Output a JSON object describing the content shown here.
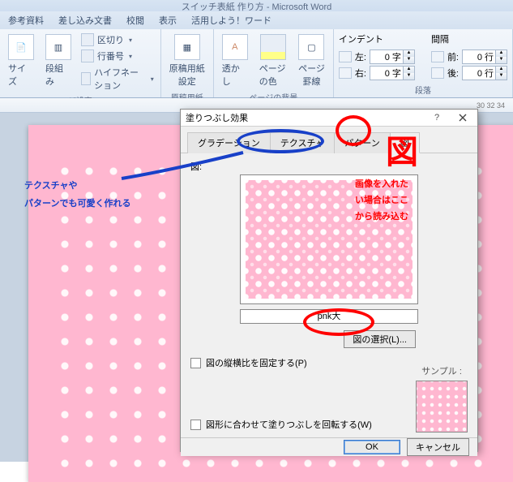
{
  "app_title": "スイッチ表紙 作り方 - Microsoft Word",
  "ribbon_tabs": [
    "参考資料",
    "差し込み文書",
    "校閲",
    "表示",
    "活用しよう！ワード"
  ],
  "ribbon": {
    "group_page_setup": {
      "size_btn": "サイズ",
      "columns_btn": "段組み",
      "breaks": "区切り",
      "line_numbers": "行番号",
      "hyphenation": "ハイフネーション",
      "label": "ジ設定"
    },
    "group_genkou": {
      "btn": "原稿用紙\n設定",
      "label": "原稿用紙"
    },
    "group_bg": {
      "watermark": "透かし",
      "page_color": "ページの色",
      "page_border": "ページ\n罫線",
      "label": "ページの背景"
    },
    "group_para": {
      "title": "インデント",
      "left_label": "左:",
      "left_val": "0 字",
      "right_label": "右:",
      "right_val": "0 字",
      "spacing_title": "間隔",
      "before_label": "前:",
      "before_val": "0 行",
      "after_label": "後:",
      "after_val": "0 行",
      "label": "段落"
    }
  },
  "ruler_text": "30    32    34",
  "dialog": {
    "title": "塗りつぶし効果",
    "tabs": [
      "グラデーション",
      "テクスチャ",
      "パターン",
      "図"
    ],
    "active_tab": 3,
    "section_label": "図:",
    "image_name": "pnk大",
    "pick_button": "図の選択(L)...",
    "lock_aspect": "図の縦横比を固定する(P)",
    "rotate_fill": "図形に合わせて塗りつぶしを回転する(W)",
    "sample_label": "サンプル :",
    "ok": "OK",
    "cancel": "キャンセル"
  },
  "annotations": {
    "blue_line1": "テクスチャや",
    "blue_line2": "パターンでも可愛く作れる",
    "red_big": "図",
    "red_line1": "画像を入れた",
    "red_line2": "い場合はここ",
    "red_line3": "から読み込む"
  }
}
